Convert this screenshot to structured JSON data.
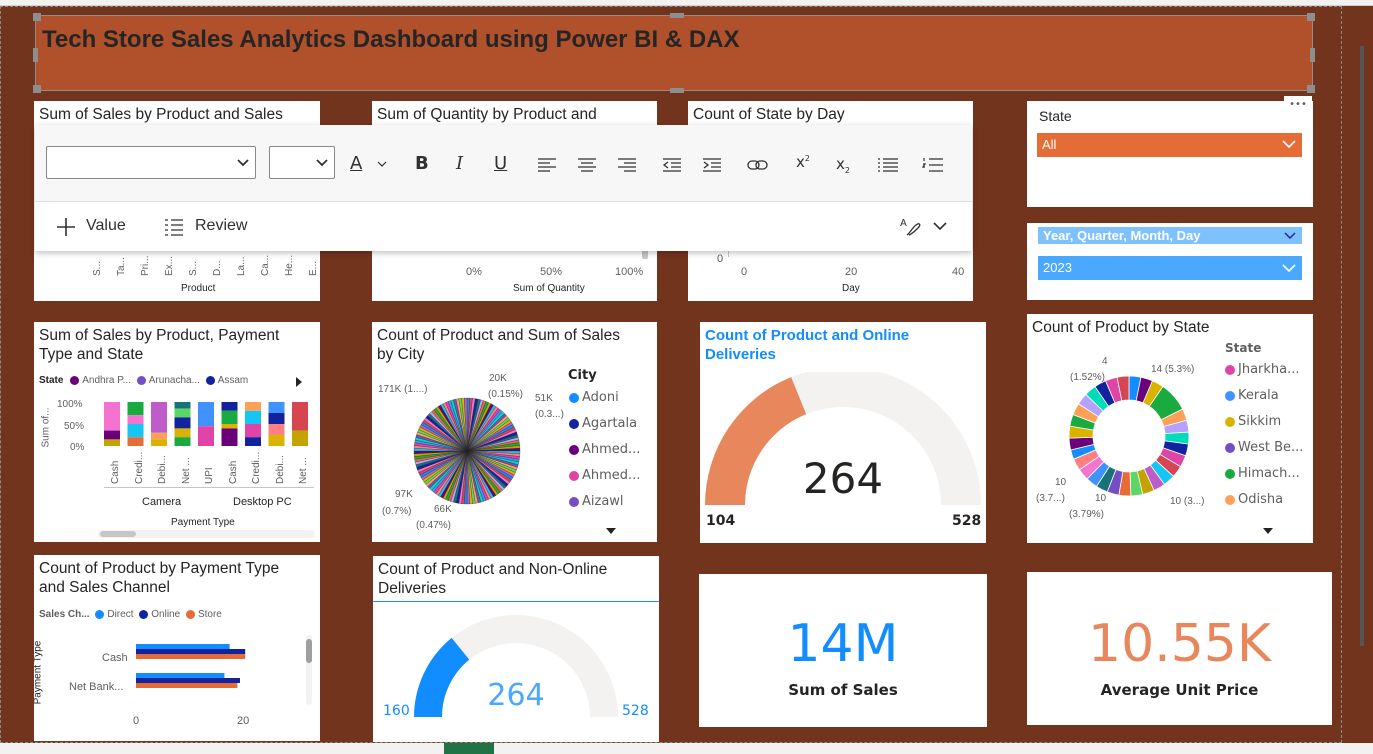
{
  "header": {
    "title": "Tech Store Sales Analytics Dashboard using Power BI & DAX"
  },
  "toolbar": {
    "value_label": "Value",
    "review_label": "Review"
  },
  "visuals": {
    "sales_by_product": {
      "title": "Sum of Sales by Product and Sales",
      "x_title": "Product",
      "tick_labels": [
        "S...",
        "Ta...",
        "Pri...",
        "Ex...",
        "S...",
        "D...",
        "La...",
        "Ca...",
        "He...",
        "E..."
      ]
    },
    "qty_by_product": {
      "title": "Sum of Quantity by Product and",
      "x_title": "Sum of Quantity",
      "ticks": [
        "0%",
        "50%",
        "100%"
      ]
    },
    "state_by_day": {
      "title": "Count of State by Day",
      "x_title": "Day",
      "y_tick": "0",
      "ticks": [
        "0",
        "20",
        "40"
      ]
    },
    "state_slicer": {
      "title": "State",
      "value": "All",
      "more": "•••"
    },
    "date_slicer": {
      "header": "Year, Quarter, Month, Day",
      "value": "2023"
    },
    "sales_payment": {
      "title_line1": "Sum of Sales by Product, Payment",
      "title_line2": "Type and State",
      "legend_title": "State",
      "legend": [
        "Andhra P...",
        "Arunacha...",
        "Assam"
      ],
      "y_title": "Sum of...",
      "y_ticks": [
        "100%",
        "50%",
        "0%"
      ],
      "x_labels": [
        "Cash",
        "Credi...",
        "Debi...",
        "Net ...",
        "UPI",
        "Cash",
        "Credi...",
        "Debi...",
        "Net ..."
      ],
      "groups": [
        "Camera",
        "Desktop PC"
      ],
      "x_title": "Payment Type"
    },
    "city_pie": {
      "title_line1": "Count of Product and Sum of Sales",
      "title_line2": "by City",
      "labels": [
        "171K (1....)",
        "20K",
        "(0.15%)",
        "51K",
        "(0.3...)",
        "97K",
        "(0.7%)",
        "66K",
        "(0.47%)"
      ],
      "legend_title": "City",
      "legend": [
        "Adoni",
        "Agartala",
        "Ahmed...",
        "Ahmed...",
        "Aizawl"
      ]
    },
    "online_gauge": {
      "title_line1": "Count of Product and Online",
      "title_line2": "Deliveries",
      "value": "264",
      "min": "104",
      "max": "528"
    },
    "state_donut": {
      "title": "Count of Product by State",
      "labels": [
        "4",
        "(1.52%)",
        "14 (5.3%)",
        "10",
        "(3.7...)",
        "10",
        "(3.79%)",
        "10 (3...)"
      ],
      "legend_title": "State",
      "legend": [
        "Jharkha...",
        "Kerala",
        "Sikkim",
        "West Be...",
        "Himach...",
        "Odisha"
      ]
    },
    "payment_channel": {
      "title_line1": "Count of Product by Payment Type",
      "title_line2": "and Sales Channel",
      "legend_title": "Sales Ch...",
      "legend": [
        "Direct",
        "Online",
        "Store"
      ],
      "y_title": "Payment Type",
      "categories": [
        "Cash",
        "Net Bank..."
      ],
      "ticks": [
        "0",
        "20"
      ]
    },
    "nononline_gauge": {
      "title_line1": "Count of Product and Non-Online",
      "title_line2": "Deliveries",
      "value": "264",
      "min": "160",
      "max": "528"
    },
    "sum_sales_card": {
      "value": "14M",
      "label": "Sum of Sales"
    },
    "avg_price_card": {
      "value": "10.55K",
      "label": "Average Unit Price"
    }
  },
  "colors": {
    "canvas": "#73341e",
    "banner": "#b0512b",
    "orange": "#e66c37",
    "blue": "#118dff",
    "navy": "#12239e",
    "gauge_orange": "#e8875c"
  }
}
